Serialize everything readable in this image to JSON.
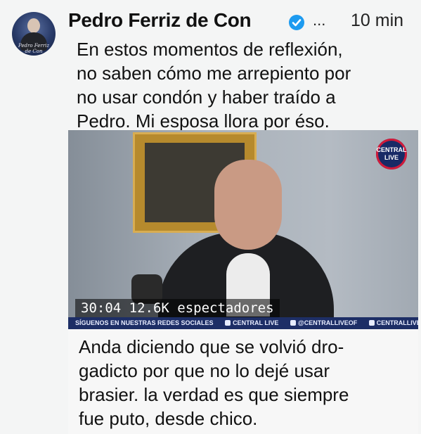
{
  "author": {
    "name": "Pedro Ferriz de Con",
    "avatar_signature": "Pedro Ferriz de Con"
  },
  "header": {
    "more_label": "...",
    "timestamp": "10 min"
  },
  "post": {
    "lines": [
      "En estos momentos de reflexión,",
      "no saben cómo me arrepiento por",
      "no usar condón y haber traído a",
      "Pedro. Mi esposa llora por éso."
    ]
  },
  "video": {
    "live_badge": "CENTRAL LIVE",
    "timestamp": "30:04",
    "viewers": "12.6K espectadores",
    "ticker": {
      "follow_text": "SÍGUENOS EN NUESTRAS REDES SOCIALES",
      "items": [
        "CENTRAL LIVE",
        "@CENTRALLIVEOF",
        "CENTRALLIVEOFICIAL"
      ]
    }
  },
  "caption": {
    "lines": [
      "Anda diciendo que se volvió dro-",
      "gadicto por que no lo dejé usar",
      "brasier. la verdad es que siempre",
      "fue puto, desde chico."
    ]
  },
  "colors": {
    "verified": "#1d9bf0",
    "ticker_bg": "#1d2e66",
    "badge_ring": "#d11a3a"
  },
  "icons": [
    "verified-badge-icon",
    "more-options-icon",
    "facebook-icon",
    "twitter-icon",
    "instagram-icon"
  ]
}
